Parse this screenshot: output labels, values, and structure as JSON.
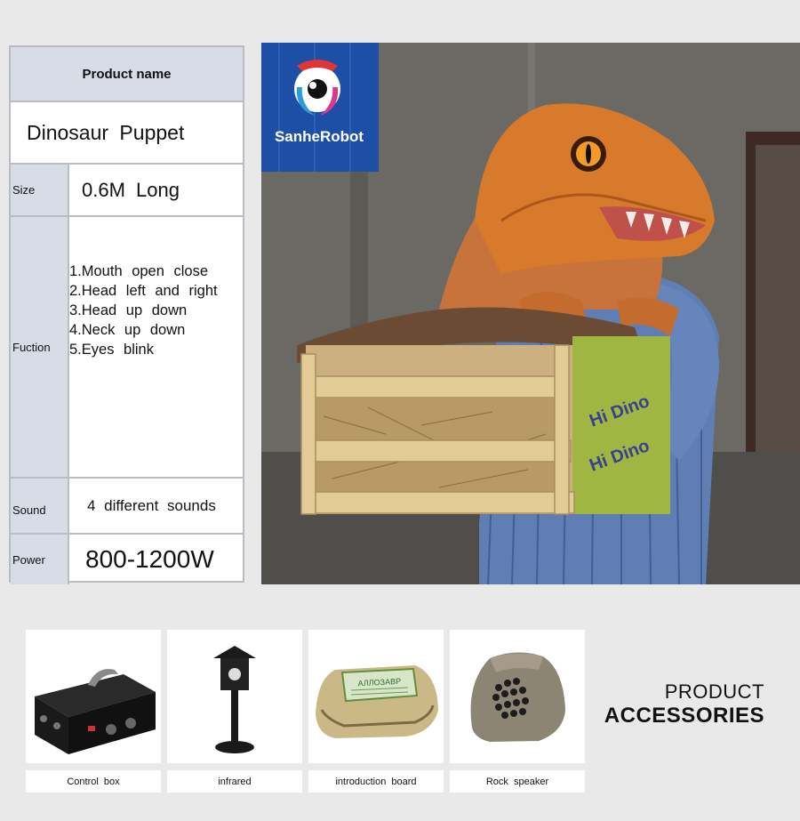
{
  "spec_table": {
    "header": "Product  name",
    "product_name": "Dinosaur  Puppet",
    "size_label": "Size",
    "size_value": "0.6M  Long",
    "function_label": "Fuction",
    "functions": [
      "1.Mouth  open  close",
      "2.Head  left  and  right",
      "3.Head  up  down",
      "4.Neck  up  down",
      "5.Eyes  blink"
    ],
    "sound_label": "Sound",
    "sound_value": "4  different  sounds",
    "power_label": "Power",
    "power_value": "800-1200W"
  },
  "photo": {
    "logo_text": "SanheRobot",
    "crate_text": "Hi Dino"
  },
  "accessories": {
    "title_line1": "PRODUCT",
    "title_line2": "ACCESSORIES",
    "items": [
      {
        "label": "Control  box",
        "icon": "control-box"
      },
      {
        "label": "infrared",
        "icon": "infrared-sensor"
      },
      {
        "label": "introduction  board",
        "icon": "rock-board",
        "board_text": "АЛЛОЗАВР"
      },
      {
        "label": "Rock  speaker",
        "icon": "rock-speaker"
      }
    ]
  },
  "colors": {
    "background": "#e9e9e9",
    "table_header": "#d7dce7",
    "table_border": "#b9bcc4",
    "dino_orange": "#d77a2c"
  }
}
